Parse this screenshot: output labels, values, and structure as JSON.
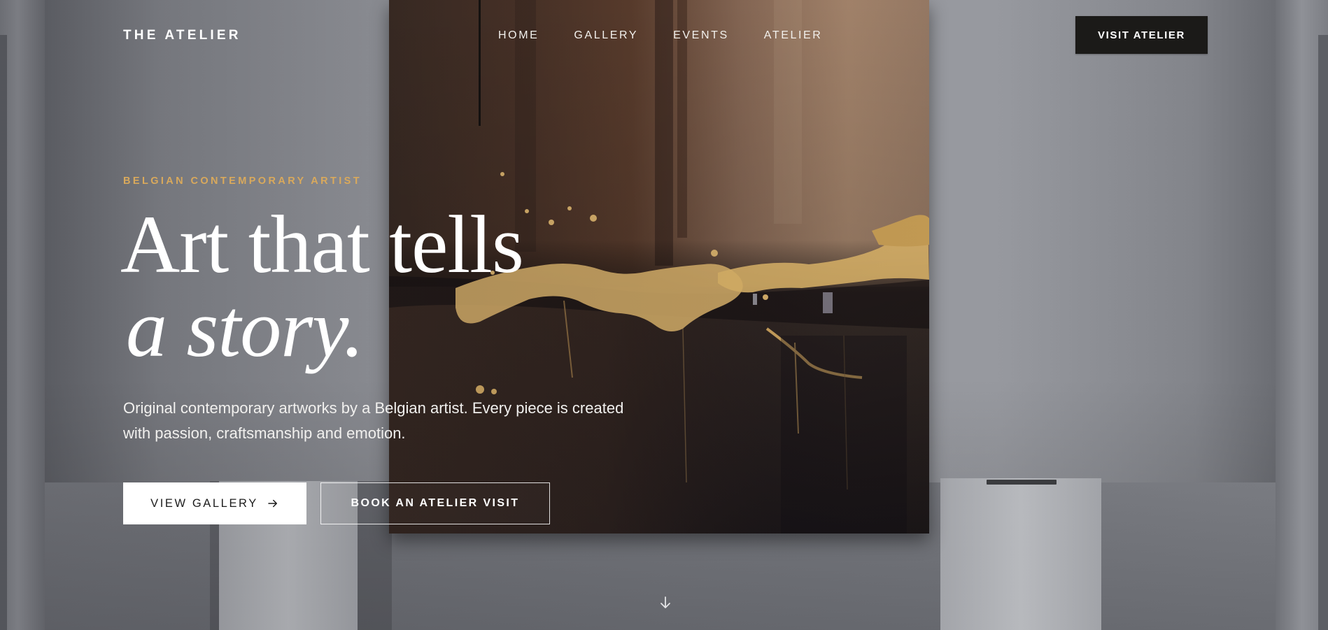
{
  "brand": {
    "name": "THE ATELIER"
  },
  "nav": {
    "items": [
      {
        "label": "HOME"
      },
      {
        "label": "GALLERY"
      },
      {
        "label": "EVENTS"
      },
      {
        "label": "ATELIER"
      }
    ],
    "cta_label": "VISIT ATELIER"
  },
  "hero": {
    "eyebrow": "BELGIAN CONTEMPORARY ARTIST",
    "headline_line1": "Art that tells",
    "headline_line2": "a story.",
    "lede": "Original contemporary artworks by a Belgian artist. Every piece is created with passion, craftsmanship and emotion.",
    "primary_button": "VIEW GALLERY",
    "secondary_button": "BOOK AN ATELIER VISIT"
  },
  "icons": {
    "primary_button_icon": "arrow-right-icon",
    "scroll_indicator": "arrow-down-icon"
  },
  "colors": {
    "accent": "#d9a95c",
    "dark": "#1b1a18",
    "text_light": "#ffffff"
  }
}
